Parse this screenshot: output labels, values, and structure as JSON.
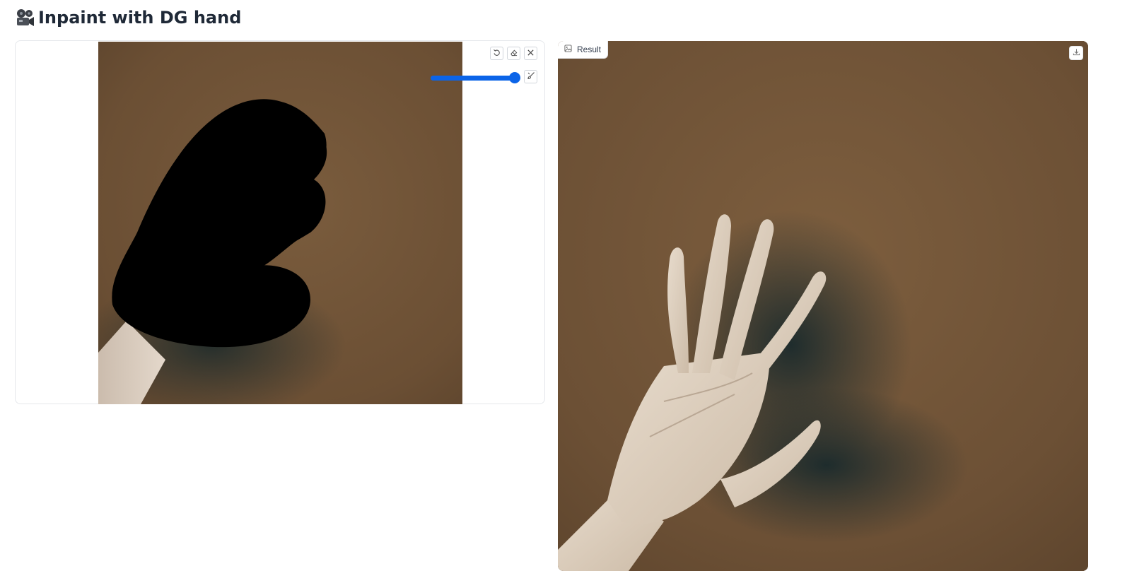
{
  "app": {
    "title": "Inpaint with DG hand",
    "title_icon": "movie-camera-icon"
  },
  "editor": {
    "tools": [
      {
        "name": "undo-icon"
      },
      {
        "name": "eraser-icon"
      },
      {
        "name": "close-icon"
      },
      {
        "name": "brush-icon"
      }
    ],
    "brush_size_level": 1.0,
    "slider_color": "#0b64e8"
  },
  "result": {
    "label": "Result",
    "label_icon": "image-icon",
    "action_icon": "download-icon"
  },
  "colors": {
    "background_brown": "#6e5236",
    "mask": "#000000",
    "skin": "#d9cdbf"
  }
}
